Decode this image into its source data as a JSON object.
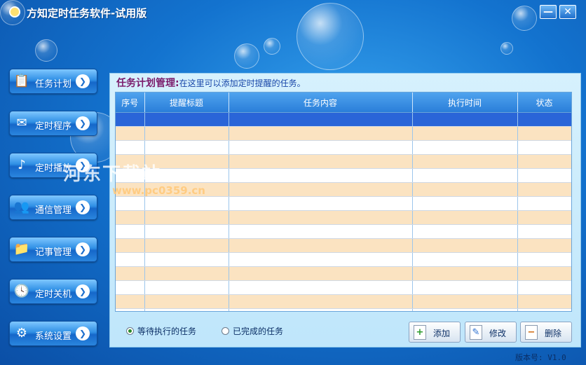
{
  "window": {
    "title": "方知定时任务软件-试用版",
    "minimize": "—",
    "close": "✕"
  },
  "nav": [
    {
      "label": "任务计划",
      "icon": "📋"
    },
    {
      "label": "定时程序",
      "icon": "✉"
    },
    {
      "label": "定时播放",
      "icon": "♪"
    },
    {
      "label": "通信管理",
      "icon": "👥"
    },
    {
      "label": "记事管理",
      "icon": "📁"
    },
    {
      "label": "定时关机",
      "icon": "🕓"
    },
    {
      "label": "系统设置",
      "icon": "⚙"
    }
  ],
  "panel": {
    "title": "任务计划管理:",
    "description": "在这里可以添加定时提醒的任务。"
  },
  "table": {
    "columns": [
      "序号",
      "提醒标题",
      "任务内容",
      "执行时间",
      "状态"
    ],
    "rows": 15,
    "selected_row": 0
  },
  "filters": {
    "pending": "等待执行的任务",
    "done": "已完成的任务",
    "selected": "pending"
  },
  "actions": {
    "add": "添加",
    "edit": "修改",
    "delete": "删除"
  },
  "footer": {
    "version": "版本号: V1.0"
  },
  "watermark": {
    "name": "河东下载站",
    "url": "www.pc0359.cn"
  },
  "colors": {
    "accent": "#1567c9",
    "selected_row": "#2a65d8",
    "alt_row": "#fbe3c1",
    "heading": "#7a1a6a"
  }
}
